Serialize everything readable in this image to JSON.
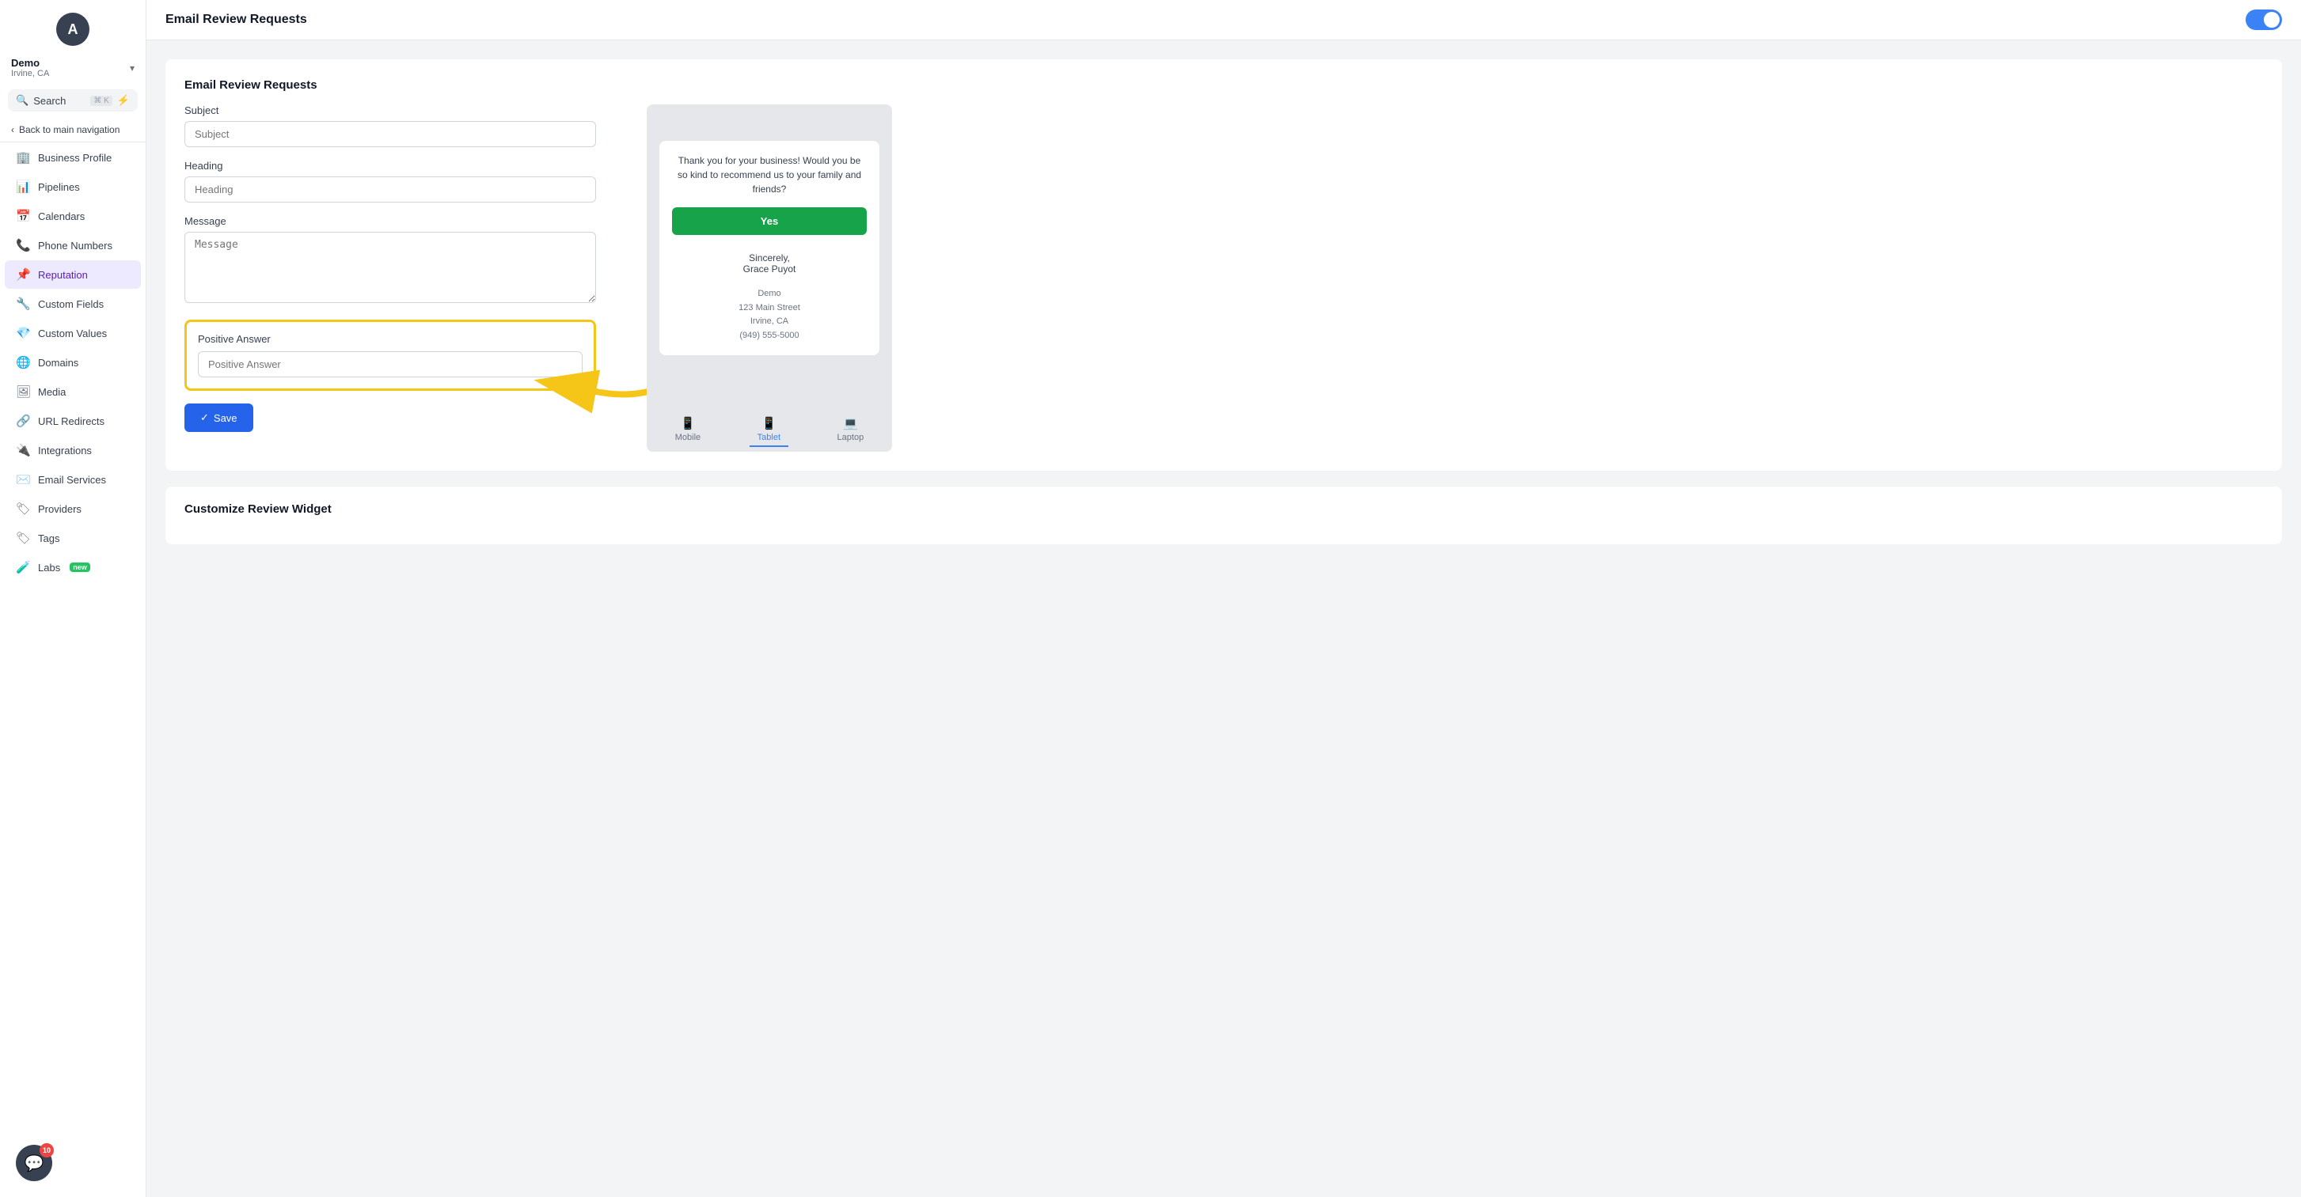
{
  "user": {
    "initials": "A",
    "name": "Demo",
    "location": "Irvine, CA"
  },
  "search": {
    "label": "Search",
    "shortcut": "⌘ K"
  },
  "nav": {
    "back_label": "Back to main navigation",
    "items": [
      {
        "id": "business-profile",
        "label": "Business Profile",
        "icon": "🏢",
        "active": false
      },
      {
        "id": "pipelines",
        "label": "Pipelines",
        "icon": "📊",
        "active": false
      },
      {
        "id": "calendars",
        "label": "Calendars",
        "icon": "📅",
        "active": false
      },
      {
        "id": "phone-numbers",
        "label": "Phone Numbers",
        "icon": "📞",
        "active": false
      },
      {
        "id": "reputation",
        "label": "Reputation",
        "icon": "📌",
        "active": true
      },
      {
        "id": "custom-fields",
        "label": "Custom Fields",
        "icon": "🔧",
        "active": false
      },
      {
        "id": "custom-values",
        "label": "Custom Values",
        "icon": "💎",
        "active": false
      },
      {
        "id": "domains",
        "label": "Domains",
        "icon": "🌐",
        "active": false
      },
      {
        "id": "media",
        "label": "Media",
        "icon": "🖼",
        "active": false
      },
      {
        "id": "url-redirects",
        "label": "URL Redirects",
        "icon": "🔗",
        "active": false
      },
      {
        "id": "integrations",
        "label": "Integrations",
        "icon": "🔌",
        "active": false
      },
      {
        "id": "email-services",
        "label": "Email Services",
        "icon": "✉️",
        "active": false
      },
      {
        "id": "providers",
        "label": "Providers",
        "icon": "🏷",
        "active": false
      },
      {
        "id": "tags",
        "label": "Tags",
        "icon": "🏷",
        "active": false
      },
      {
        "id": "labs",
        "label": "Labs",
        "icon": "🧪",
        "active": false,
        "badge": "new"
      }
    ]
  },
  "chat_badge": "10",
  "page": {
    "title": "Email Review Requests",
    "toggle_on": true
  },
  "form": {
    "section_title": "Email Review Requests",
    "subject_label": "Subject",
    "subject_placeholder": "Subject",
    "heading_label": "Heading",
    "heading_placeholder": "Heading",
    "message_label": "Message",
    "message_placeholder": "Message",
    "positive_answer_label": "Positive Answer",
    "positive_answer_placeholder": "Positive Answer",
    "save_label": "Save"
  },
  "preview": {
    "body_text": "Thank you for your business! Would you be so kind to recommend us to your family and friends?",
    "yes_button_label": "Yes",
    "sincerely_label": "Sincerely,",
    "signature_name": "Grace Puyot",
    "address_line1": "Demo",
    "address_line2": "123 Main Street",
    "address_line3": "Irvine, CA",
    "address_line4": "(949) 555-5000",
    "tabs": [
      {
        "id": "mobile",
        "label": "Mobile",
        "icon": "📱"
      },
      {
        "id": "tablet",
        "label": "Tablet",
        "icon": "📱",
        "active": true
      },
      {
        "id": "laptop",
        "label": "Laptop",
        "icon": "💻"
      }
    ]
  },
  "customize_section": {
    "title": "Customize Review Widget"
  }
}
